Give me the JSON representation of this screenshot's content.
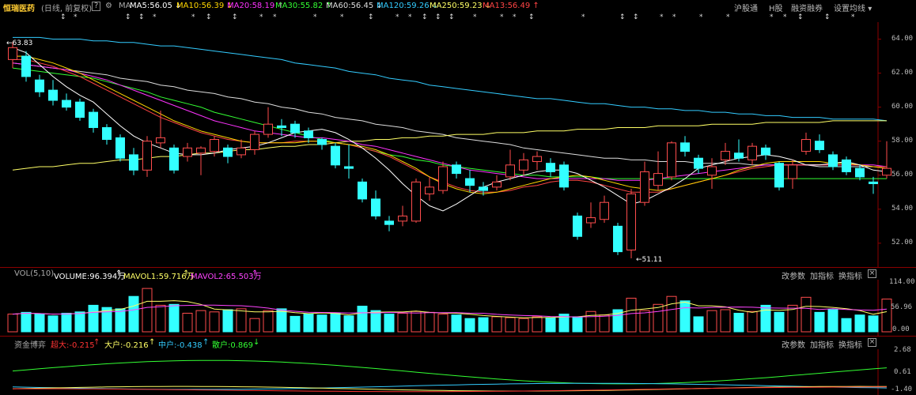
{
  "header": {
    "stock_name": "恒瑞医药",
    "period": "(日线, 前复权)",
    "help": "?",
    "settings_icon": "gear-icon",
    "ma_label": "MA",
    "ma_values": [
      {
        "label": "MA5:56.05",
        "arrow": "↓",
        "color": "#ffffff"
      },
      {
        "label": "MA10:56.39",
        "arrow": "↓",
        "color": "#ffd700"
      },
      {
        "label": "MA20:58.19",
        "arrow": "↑",
        "color": "#ff33ff"
      },
      {
        "label": "MA30:55.82",
        "arrow": "↑",
        "color": "#33ff33"
      },
      {
        "label": "MA60:56.45",
        "arrow": "↓",
        "color": "#dddddd"
      },
      {
        "label": "MA120:59.26",
        "arrow": "↓",
        "color": "#33ccff"
      },
      {
        "label": "MA250:59.23",
        "arrow": "↓",
        "color": "#ffff66"
      },
      {
        "label": "MA13:56.49",
        "arrow": "↑",
        "color": "#ff4444"
      }
    ],
    "nav": [
      "沪股通",
      "H股",
      "融资融券",
      "设置均线"
    ]
  },
  "main_chart": {
    "y_ticks": [
      "64.00",
      "62.00",
      "60.00",
      "58.00",
      "56.00",
      "54.00",
      "52.00"
    ],
    "high_marker": "63.83",
    "low_marker": "51.11"
  },
  "volume_panel": {
    "title": "VOL(5,10)",
    "volume": "VOLUME:96.394万",
    "mavol1": "MAVOL1:59.716万",
    "mavol2": "MAVOL2:65.503万",
    "buttons": [
      "改参数",
      "加指标",
      "换指标"
    ],
    "close": "×",
    "y_ticks": [
      "114.00",
      "56.96",
      "0.00"
    ]
  },
  "fund_panel": {
    "title": "资金博弈",
    "super": "超大:-0.215",
    "big": "大户:-0.216",
    "mid": "中户:-0.438",
    "small": "散户:0.869",
    "buttons": [
      "改参数",
      "加指标",
      "换指标"
    ],
    "close": "×",
    "y_ticks": [
      "2.68",
      "0.61",
      "-1.40"
    ]
  },
  "chart_data": {
    "type": "candlestick",
    "candles": [
      {
        "o": 62.8,
        "c": 63.5,
        "h": 63.83,
        "l": 62.3
      },
      {
        "o": 63.0,
        "c": 61.8,
        "h": 63.3,
        "l": 61.5
      },
      {
        "o": 61.6,
        "c": 60.9,
        "h": 61.9,
        "l": 60.6
      },
      {
        "o": 61.0,
        "c": 60.4,
        "h": 61.6,
        "l": 60.1
      },
      {
        "o": 60.4,
        "c": 60.0,
        "h": 60.8,
        "l": 59.8
      },
      {
        "o": 60.3,
        "c": 59.4,
        "h": 60.5,
        "l": 59.2
      },
      {
        "o": 59.7,
        "c": 58.8,
        "h": 59.9,
        "l": 58.5
      },
      {
        "o": 58.8,
        "c": 58.1,
        "h": 59.0,
        "l": 57.8
      },
      {
        "o": 58.2,
        "c": 57.0,
        "h": 58.4,
        "l": 56.8
      },
      {
        "o": 57.2,
        "c": 56.3,
        "h": 57.6,
        "l": 56.0
      },
      {
        "o": 56.3,
        "c": 58.0,
        "h": 58.3,
        "l": 55.9
      },
      {
        "o": 57.9,
        "c": 58.2,
        "h": 59.8,
        "l": 57.6
      },
      {
        "o": 57.6,
        "c": 56.3,
        "h": 57.8,
        "l": 56.1
      },
      {
        "o": 57.1,
        "c": 57.6,
        "h": 57.9,
        "l": 56.8
      },
      {
        "o": 57.3,
        "c": 57.6,
        "h": 57.7,
        "l": 56.0
      },
      {
        "o": 57.4,
        "c": 58.1,
        "h": 58.3,
        "l": 57.1
      },
      {
        "o": 57.6,
        "c": 57.1,
        "h": 57.8,
        "l": 56.7
      },
      {
        "o": 57.2,
        "c": 57.6,
        "h": 58.1,
        "l": 57.0
      },
      {
        "o": 57.5,
        "c": 58.4,
        "h": 58.6,
        "l": 57.2
      },
      {
        "o": 58.4,
        "c": 59.0,
        "h": 60.0,
        "l": 58.2
      },
      {
        "o": 58.9,
        "c": 58.8,
        "h": 59.3,
        "l": 58.3
      },
      {
        "o": 59.0,
        "c": 58.5,
        "h": 59.2,
        "l": 58.2
      },
      {
        "o": 58.6,
        "c": 58.2,
        "h": 58.8,
        "l": 57.9
      },
      {
        "o": 58.1,
        "c": 57.8,
        "h": 58.2,
        "l": 57.5
      },
      {
        "o": 57.7,
        "c": 56.6,
        "h": 57.9,
        "l": 56.4
      },
      {
        "o": 56.5,
        "c": 56.4,
        "h": 57.8,
        "l": 55.8
      },
      {
        "o": 55.6,
        "c": 54.6,
        "h": 55.8,
        "l": 54.4
      },
      {
        "o": 54.6,
        "c": 53.6,
        "h": 55.1,
        "l": 53.4
      },
      {
        "o": 53.3,
        "c": 53.1,
        "h": 53.6,
        "l": 52.7
      },
      {
        "o": 53.3,
        "c": 53.6,
        "h": 54.2,
        "l": 53.0
      },
      {
        "o": 53.3,
        "c": 55.6,
        "h": 55.8,
        "l": 53.2
      },
      {
        "o": 54.9,
        "c": 55.3,
        "h": 55.9,
        "l": 54.5
      },
      {
        "o": 55.1,
        "c": 56.5,
        "h": 56.8,
        "l": 54.9
      },
      {
        "o": 56.6,
        "c": 56.1,
        "h": 56.8,
        "l": 55.8
      },
      {
        "o": 55.8,
        "c": 55.4,
        "h": 56.3,
        "l": 55.0
      },
      {
        "o": 55.3,
        "c": 55.1,
        "h": 55.6,
        "l": 54.8
      },
      {
        "o": 55.3,
        "c": 55.6,
        "h": 56.0,
        "l": 55.1
      },
      {
        "o": 55.9,
        "c": 56.6,
        "h": 57.5,
        "l": 55.7
      },
      {
        "o": 56.3,
        "c": 56.9,
        "h": 57.3,
        "l": 56.0
      },
      {
        "o": 56.8,
        "c": 57.1,
        "h": 57.4,
        "l": 56.3
      },
      {
        "o": 56.7,
        "c": 56.2,
        "h": 57.0,
        "l": 55.9
      },
      {
        "o": 56.6,
        "c": 55.3,
        "h": 56.8,
        "l": 55.1
      },
      {
        "o": 53.6,
        "c": 52.4,
        "h": 53.8,
        "l": 52.2
      },
      {
        "o": 53.2,
        "c": 53.5,
        "h": 54.4,
        "l": 52.9
      },
      {
        "o": 53.4,
        "c": 54.4,
        "h": 54.8,
        "l": 53.2
      },
      {
        "o": 53.0,
        "c": 51.5,
        "h": 53.2,
        "l": 51.3
      },
      {
        "o": 51.6,
        "c": 54.9,
        "h": 55.2,
        "l": 51.11
      },
      {
        "o": 54.4,
        "c": 56.2,
        "h": 56.8,
        "l": 54.2
      },
      {
        "o": 55.4,
        "c": 56.1,
        "h": 57.4,
        "l": 55.1
      },
      {
        "o": 55.9,
        "c": 57.9,
        "h": 58.0,
        "l": 55.7
      },
      {
        "o": 57.9,
        "c": 57.4,
        "h": 58.3,
        "l": 57.1
      },
      {
        "o": 57.0,
        "c": 56.4,
        "h": 57.2,
        "l": 56.1
      },
      {
        "o": 56.0,
        "c": 56.5,
        "h": 57.0,
        "l": 55.2
      },
      {
        "o": 56.9,
        "c": 57.4,
        "h": 57.9,
        "l": 56.6
      },
      {
        "o": 57.3,
        "c": 57.0,
        "h": 58.1,
        "l": 56.8
      },
      {
        "o": 56.9,
        "c": 57.7,
        "h": 57.9,
        "l": 56.6
      },
      {
        "o": 57.6,
        "c": 57.2,
        "h": 57.8,
        "l": 56.9
      },
      {
        "o": 56.7,
        "c": 55.3,
        "h": 56.8,
        "l": 55.1
      },
      {
        "o": 55.8,
        "c": 56.6,
        "h": 56.9,
        "l": 55.2
      },
      {
        "o": 57.4,
        "c": 58.1,
        "h": 58.5,
        "l": 57.2
      },
      {
        "o": 58.0,
        "c": 57.5,
        "h": 58.4,
        "l": 57.3
      },
      {
        "o": 57.2,
        "c": 56.5,
        "h": 57.4,
        "l": 56.3
      },
      {
        "o": 56.9,
        "c": 56.2,
        "h": 57.1,
        "l": 56.0
      },
      {
        "o": 56.4,
        "c": 55.9,
        "h": 56.6,
        "l": 55.7
      },
      {
        "o": 55.6,
        "c": 55.5,
        "h": 55.9,
        "l": 54.9
      },
      {
        "o": 56.0,
        "c": 56.4,
        "h": 58.0,
        "l": 55.8
      }
    ],
    "volume": [
      40,
      44,
      40,
      36,
      42,
      45,
      60,
      55,
      52,
      80,
      98,
      60,
      62,
      42,
      48,
      45,
      50,
      52,
      30,
      48,
      52,
      35,
      40,
      38,
      42,
      36,
      58,
      48,
      40,
      42,
      46,
      44,
      40,
      38,
      30,
      32,
      34,
      32,
      30,
      34,
      32,
      40,
      34,
      46,
      38,
      50,
      76,
      48,
      62,
      80,
      70,
      34,
      48,
      50,
      42,
      46,
      60,
      44,
      60,
      78,
      44,
      50,
      30,
      38,
      36,
      74
    ],
    "ma_lines": {
      "MA5": [
        63.5,
        63.2,
        62.5,
        61.8,
        61.2,
        60.7,
        60.3,
        59.6,
        58.9,
        58.3,
        57.9,
        57.6,
        57.3,
        57.2,
        57.2,
        57.3,
        57.5,
        57.6,
        57.7,
        57.9,
        58.2,
        58.5,
        58.6,
        58.7,
        58.5,
        58.1,
        57.6,
        57.0,
        56.3,
        55.5,
        54.8,
        54.2,
        53.9,
        54.3,
        54.8,
        55.3,
        55.6,
        55.8,
        56.0,
        56.2,
        56.3,
        56.3,
        56.1,
        55.7,
        55.3,
        54.8,
        54.3,
        54.5,
        54.9,
        55.3,
        55.8,
        56.4,
        56.6,
        56.8,
        57.0,
        57.1,
        57.2,
        57.1,
        56.9,
        56.6,
        56.6,
        56.7,
        56.8,
        56.6,
        56.3,
        56.2
      ],
      "MA10": [
        63.0,
        63.0,
        62.8,
        62.6,
        62.3,
        62.0,
        61.6,
        61.2,
        60.8,
        60.4,
        60.0,
        59.6,
        59.2,
        58.9,
        58.6,
        58.4,
        58.2,
        58.0,
        57.9,
        57.9,
        57.9,
        57.9,
        58.0,
        58.0,
        57.9,
        57.8,
        57.7,
        57.5,
        57.2,
        56.8,
        56.4,
        55.9,
        55.5,
        55.2,
        55.0,
        54.9,
        55.0,
        55.2,
        55.4,
        55.6,
        55.8,
        55.9,
        56.0,
        55.9,
        55.7,
        55.5,
        55.3,
        55.2,
        55.1,
        55.2,
        55.4,
        55.6,
        55.8,
        56.0,
        56.3,
        56.5,
        56.7,
        56.8,
        56.8,
        56.8,
        56.8,
        56.7,
        56.7,
        56.6,
        56.5,
        56.4
      ],
      "MA20": [
        62.6,
        62.5,
        62.4,
        62.3,
        62.2,
        62.0,
        61.8,
        61.6,
        61.3,
        61.0,
        60.7,
        60.4,
        60.1,
        59.8,
        59.5,
        59.2,
        59.0,
        58.8,
        58.6,
        58.5,
        58.4,
        58.3,
        58.2,
        58.2,
        58.1,
        58.0,
        57.8,
        57.7,
        57.5,
        57.3,
        57.1,
        56.9,
        56.7,
        56.5,
        56.3,
        56.2,
        56.1,
        56.0,
        55.9,
        55.8,
        55.8,
        55.8,
        55.8,
        55.8,
        55.8,
        55.7,
        55.7,
        55.7,
        55.8,
        55.9,
        56.0,
        56.1,
        56.2,
        56.3,
        56.4,
        56.5,
        56.6,
        56.6,
        56.6,
        56.6,
        56.6,
        56.6,
        56.6,
        56.6,
        56.6,
        56.5
      ],
      "MA30": [
        62.3,
        62.2,
        62.1,
        62.0,
        61.9,
        61.8,
        61.7,
        61.5,
        61.3,
        61.1,
        60.9,
        60.6,
        60.4,
        60.2,
        60.0,
        59.7,
        59.5,
        59.3,
        59.1,
        58.9,
        58.7,
        58.5,
        58.3,
        58.1,
        57.9,
        57.8,
        57.6,
        57.4,
        57.2,
        57.1,
        56.9,
        56.8,
        56.6,
        56.5,
        56.4,
        56.3,
        56.2,
        56.1,
        56.0,
        56.0,
        55.9,
        55.9,
        55.9,
        55.9,
        55.8,
        55.8,
        55.8,
        55.8,
        55.8,
        55.8,
        55.8,
        55.8,
        55.8,
        55.8,
        55.8,
        55.8,
        55.8,
        55.8,
        55.8,
        55.8,
        55.8,
        55.8,
        55.8,
        55.8,
        55.8,
        55.8
      ],
      "MA60": [
        62.6,
        62.5,
        62.4,
        62.3,
        62.2,
        62.1,
        62.0,
        61.9,
        61.7,
        61.6,
        61.5,
        61.3,
        61.2,
        61.0,
        60.9,
        60.8,
        60.6,
        60.5,
        60.3,
        60.2,
        60.0,
        59.9,
        59.7,
        59.6,
        59.4,
        59.3,
        59.2,
        59.0,
        58.9,
        58.8,
        58.6,
        58.5,
        58.4,
        58.2,
        58.1,
        58.0,
        57.9,
        57.8,
        57.6,
        57.5,
        57.4,
        57.3,
        57.2,
        57.1,
        57.0,
        57.0,
        56.9,
        56.9,
        56.8,
        56.8,
        56.8,
        56.7,
        56.7,
        56.7,
        56.7,
        56.6,
        56.6,
        56.6,
        56.6,
        56.6,
        56.5,
        56.5,
        56.5,
        56.5,
        56.5,
        56.5
      ],
      "MA120": [
        64.1,
        64.1,
        64.1,
        64.0,
        64.0,
        64.0,
        63.9,
        63.9,
        63.8,
        63.8,
        63.7,
        63.6,
        63.6,
        63.5,
        63.4,
        63.3,
        63.2,
        63.1,
        63.0,
        62.9,
        62.8,
        62.6,
        62.5,
        62.4,
        62.3,
        62.1,
        62.0,
        61.9,
        61.7,
        61.6,
        61.5,
        61.3,
        61.2,
        61.1,
        61.0,
        60.9,
        60.8,
        60.7,
        60.6,
        60.5,
        60.5,
        60.4,
        60.3,
        60.2,
        60.2,
        60.1,
        60.0,
        60.0,
        59.9,
        59.9,
        59.8,
        59.8,
        59.7,
        59.7,
        59.6,
        59.6,
        59.5,
        59.5,
        59.4,
        59.4,
        59.4,
        59.3,
        59.3,
        59.3,
        59.3,
        59.2
      ],
      "MA250": [
        56.3,
        56.4,
        56.5,
        56.5,
        56.6,
        56.7,
        56.7,
        56.8,
        56.9,
        56.9,
        57.0,
        57.1,
        57.1,
        57.2,
        57.3,
        57.3,
        57.4,
        57.5,
        57.5,
        57.6,
        57.7,
        57.7,
        57.8,
        57.8,
        57.9,
        58.0,
        58.0,
        58.1,
        58.1,
        58.2,
        58.2,
        58.3,
        58.3,
        58.4,
        58.4,
        58.4,
        58.5,
        58.5,
        58.5,
        58.6,
        58.6,
        58.6,
        58.7,
        58.7,
        58.7,
        58.8,
        58.8,
        58.8,
        58.9,
        58.9,
        58.9,
        58.9,
        59.0,
        59.0,
        59.0,
        59.0,
        59.1,
        59.1,
        59.1,
        59.1,
        59.1,
        59.2,
        59.2,
        59.2,
        59.2,
        59.2
      ],
      "MA13": [
        62.8,
        62.8,
        62.6,
        62.4,
        62.1,
        61.8,
        61.4,
        61.0,
        60.6,
        60.2,
        59.8,
        59.4,
        59.1,
        58.8,
        58.5,
        58.3,
        58.1,
        58.0,
        57.9,
        57.9,
        57.9,
        58.0,
        58.0,
        58.0,
        57.9,
        57.8,
        57.6,
        57.4,
        57.1,
        56.7,
        56.3,
        55.9,
        55.6,
        55.3,
        55.1,
        55.0,
        55.0,
        55.1,
        55.3,
        55.4,
        55.6,
        55.7,
        55.7,
        55.6,
        55.4,
        55.2,
        55.0,
        55.0,
        55.0,
        55.2,
        55.4,
        55.6,
        55.8,
        56.0,
        56.2,
        56.4,
        56.5,
        56.6,
        56.6,
        56.6,
        56.6,
        56.6,
        56.6,
        56.6,
        56.5,
        56.5
      ]
    }
  }
}
